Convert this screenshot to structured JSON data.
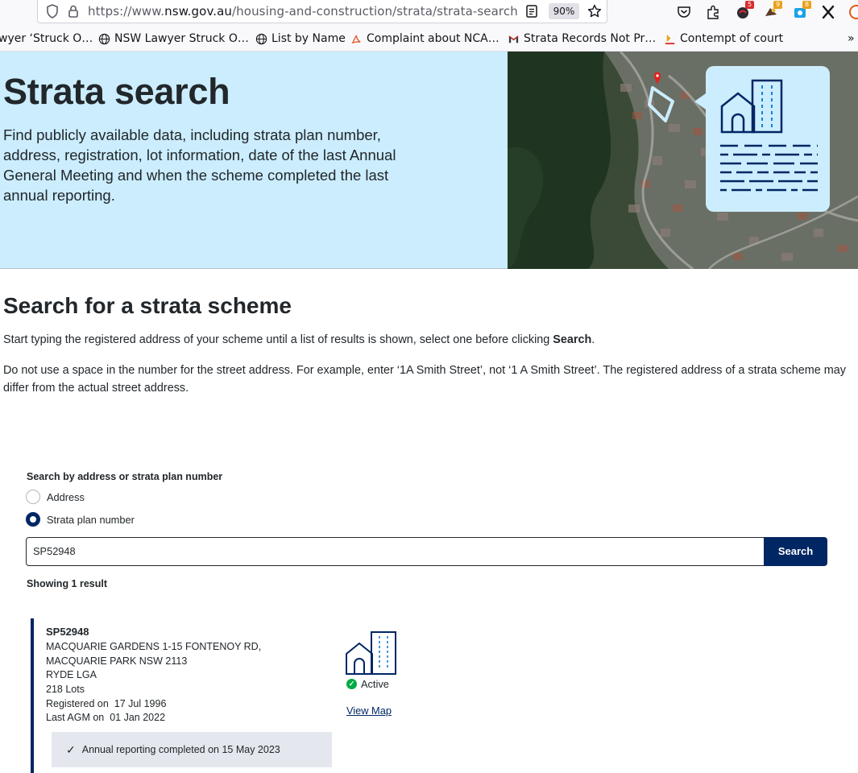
{
  "browser": {
    "url_prefix": "https://www.",
    "url_host": "nsw.gov.au",
    "url_path": "/housing-and-construction/strata/strata-search",
    "zoom": "90%",
    "extension_badges": [
      "5",
      "9",
      "8"
    ],
    "bookmarks": [
      {
        "label": "wyer ‘Struck O…",
        "icon": ""
      },
      {
        "label": "NSW Lawyer Struck O…",
        "icon": "globe-icon"
      },
      {
        "label": "List by Name",
        "icon": "globe-icon"
      },
      {
        "label": "Complaint about NCA…",
        "icon": "acrobat-icon"
      },
      {
        "label": "Strata Records Not Pr…",
        "icon": "gmail-icon"
      },
      {
        "label": "Contempt of court",
        "icon": "court-icon"
      }
    ],
    "bookmarks_overflow": "»"
  },
  "hero": {
    "title": "Strata search",
    "description": "Find publicly available data, including strata plan number, address, registration, lot information, date of the last Annual General Meeting and when the scheme completed the last annual reporting."
  },
  "content": {
    "heading": "Search for a strata scheme",
    "instruction_prefix": "Start typing the registered address of your scheme until a list of results is shown, select one before clicking ",
    "instruction_bold": "Search",
    "instruction_suffix": ".",
    "note": "Do not use a space in the number for the street address. For example, enter ‘1A Smith Street’, not ‘1 A Smith Street’. The registered address of a strata scheme may differ from the actual street address."
  },
  "form": {
    "label": "Search by address or strata plan number",
    "options": [
      {
        "label": "Address",
        "checked": false
      },
      {
        "label": "Strata plan number",
        "checked": true
      }
    ],
    "search_value": "SP52948",
    "search_button": "Search",
    "results_count": "Showing 1 result"
  },
  "result": {
    "id": "SP52948",
    "address": "MACQUARIE GARDENS 1-15 FONTENOY RD, MACQUARIE PARK NSW 2113",
    "lga": "RYDE LGA",
    "lots": "218 Lots",
    "registered_label": "Registered on",
    "registered_date": "17 Jul 1996",
    "agm_label": "Last AGM on",
    "agm_date": "01 Jan 2022",
    "status": "Active",
    "map_link": "View Map",
    "annual_reporting": "Annual reporting completed on 15 May 2023"
  },
  "colors": {
    "hero_bg": "#cbedfd",
    "primary": "#002664",
    "status_active": "#00aa45",
    "annual_bg": "#e4e8ee"
  }
}
